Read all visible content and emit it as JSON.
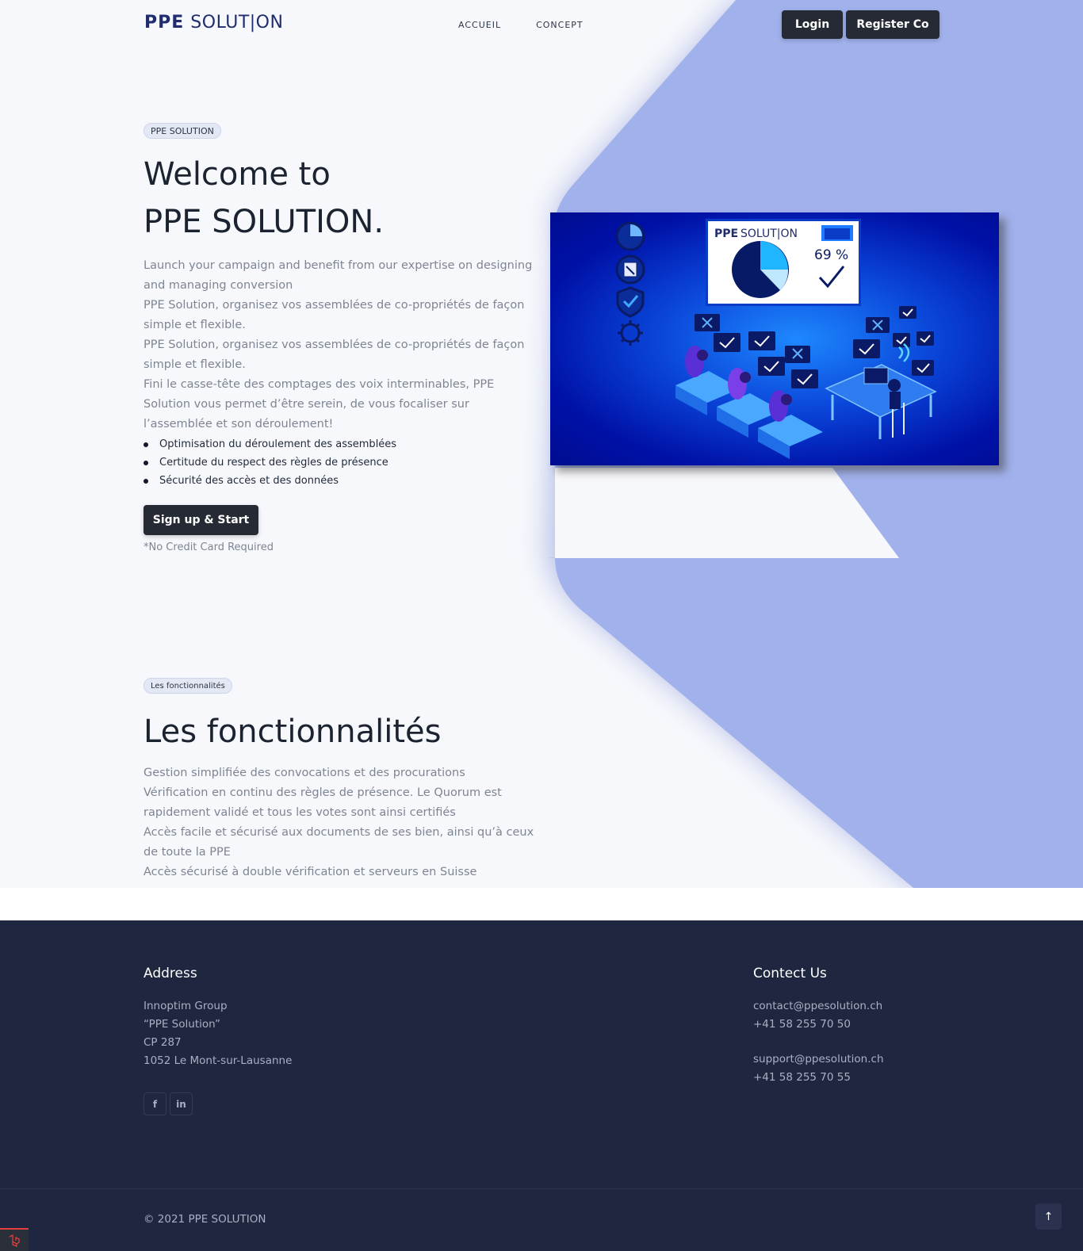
{
  "brand": {
    "logo_ppe": "PPE",
    "logo_solution": "SOLUT|ON"
  },
  "nav": {
    "items": [
      "ACCUEIL",
      "CONCEPT"
    ]
  },
  "header": {
    "login_label": "Login",
    "register_label": "Register Co"
  },
  "hero": {
    "badge": "PPE SOLUTION",
    "title_line1": "Welcome to",
    "title_line2": "PPE SOLUTION.",
    "paragraphs": [
      "Launch your campaign and benefit from our expertise on designing and managing conversion",
      "PPE Solution, organisez vos assemblées de co-propriétés de façon simple et flexible.",
      "PPE Solution, organisez vos assemblées de co-propriétés de façon simple et flexible.",
      "Fini le casse-tête des comptages des voix interminables, PPE Solution vous permet d’être serein, de vous focaliser sur l’assemblée et son déroulement!"
    ],
    "bullets": [
      "Optimisation du déroulement des assemblées",
      "Certitude du respect des règles de présence",
      "Sécurité des accès et des données"
    ],
    "cta_label": "Sign up & Start",
    "cta_note": "*No Credit Card Required"
  },
  "illustration": {
    "logo_ppe": "PPE",
    "logo_solution": "SOLUT|ON",
    "percentage": "69 %",
    "icons": [
      "pie-chart-icon",
      "document-icon",
      "shield-check-icon",
      "virus-icon",
      "wifi-icon",
      "check-icon",
      "cross-icon"
    ]
  },
  "features": {
    "badge": "Les fonctionnalités",
    "title": "Les fonctionnalités",
    "paragraphs": [
      "Gestion simplifiée des convocations et des procurations",
      "Vérification en continu des règles de présence. Le Quorum est rapidement validé et tous les votes sont ainsi certifiés",
      "Accès facile et sécurisé aux documents de ses bien, ainsi qu’à ceux de toute la PPE",
      "Accès sécurisé à double vérification et serveurs en Suisse"
    ]
  },
  "footer": {
    "address_title": "Address",
    "address_lines": [
      "Innoptim Group",
      "“PPE Solution”",
      "CP 287",
      "1052 Le Mont-sur-Lausanne"
    ],
    "contact_title": "Contect Us",
    "contact_group1": [
      "contact@ppesolution.ch",
      "+41 58 255 70 50"
    ],
    "contact_group2": [
      "support@ppesolution.ch",
      "+41 58 255 70 55"
    ],
    "social": [
      {
        "icon": "facebook-icon",
        "glyph": "f"
      },
      {
        "icon": "linkedin-icon",
        "glyph": "in"
      }
    ],
    "copyright": "© 2021 PPE SOLUTION",
    "to_top_glyph": "↑"
  },
  "colors": {
    "accent_shape": "#a1b1ec",
    "dark_button": "#252a34",
    "footer_bg": "#1f2640",
    "brand_navy": "#1f2c6e"
  }
}
